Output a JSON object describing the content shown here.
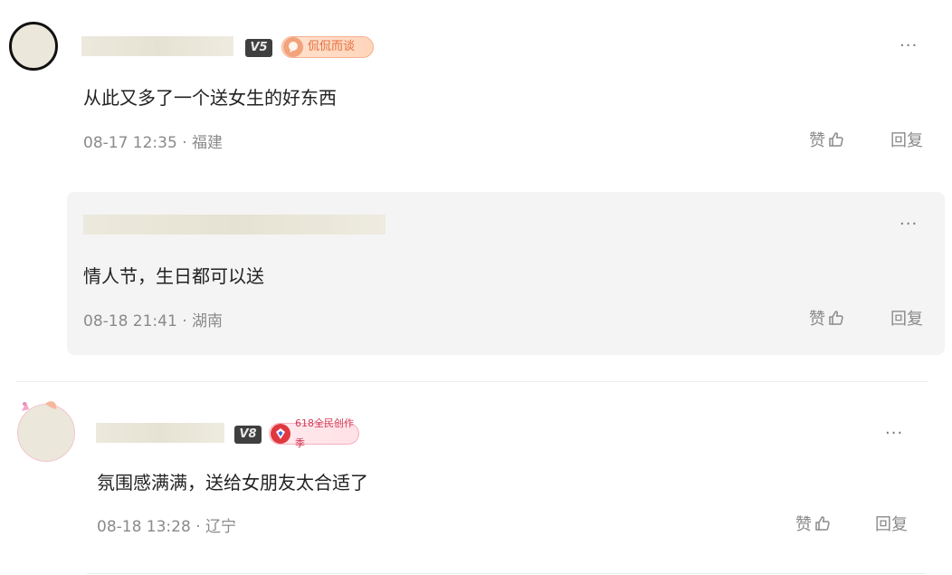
{
  "comments": [
    {
      "user_level": "V5",
      "tag_label": "侃侃而谈",
      "text": "从此又多了一个送女生的好东西",
      "date": "08-17 12:35",
      "location": "福建",
      "like_label": "赞",
      "reply_label": "回复",
      "more_label": "···"
    },
    {
      "text": "情人节，生日都可以送",
      "date": "08-18 21:41",
      "location": "湖南",
      "like_label": "赞",
      "reply_label": "回复",
      "more_label": "···"
    },
    {
      "user_level": "V8",
      "tag_label": "618全民创作季",
      "text": "氛围感满满，送给女朋友太合适了",
      "date": "08-18 13:28",
      "location": "辽宁",
      "like_label": "赞",
      "reply_label": "回复",
      "more_label": "···"
    }
  ],
  "separator": " · ",
  "icons": {
    "like": "thumbs-up-icon",
    "more": "more-dots-icon"
  },
  "colors": {
    "meta_gray": "#8a8a8a",
    "reply_bg": "#f4f4f4",
    "tag_orange": "#e46d3c",
    "tag_red": "#d23a55"
  }
}
